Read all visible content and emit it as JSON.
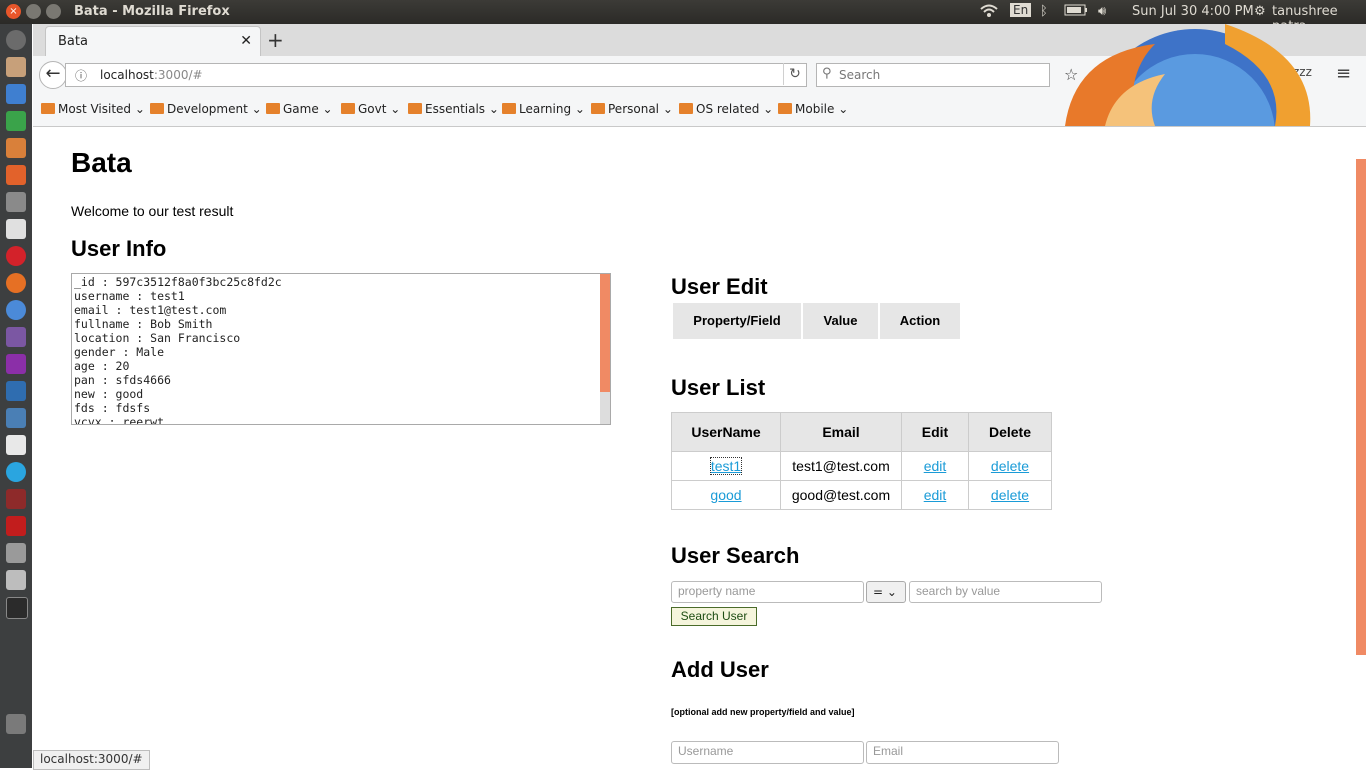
{
  "os": {
    "window_title": "Bata - Mozilla Firefox",
    "keyboard": "En",
    "clock": "Sun Jul 30  4:00 PM",
    "user": "tanushree patra"
  },
  "browser": {
    "tab_title": "Bata",
    "url_host": "localhost",
    "url_rest": ":3000/#",
    "search_placeholder": "Search",
    "bookmarks": [
      "Most Visited",
      "Development",
      "Game",
      "Govt",
      "Essentials",
      "Learning",
      "Personal",
      "OS related",
      "Mobile"
    ],
    "status_url": "localhost:3000/#"
  },
  "page": {
    "title": "Bata",
    "welcome": "Welcome to our test result",
    "user_info": {
      "heading": "User Info",
      "lines": "_id : 597c3512f8a0f3bc25c8fd2c\nusername : test1\nemail : test1@test.com\nfullname : Bob Smith\nlocation : San Francisco\ngender : Male\nage : 20\npan : sfds4666\nnew : good\nfds : fdsfs\nvcvx : reerwt"
    },
    "user_edit": {
      "heading": "User Edit",
      "columns": [
        "Property/Field",
        "Value",
        "Action"
      ]
    },
    "user_list": {
      "heading": "User List",
      "columns": [
        "UserName",
        "Email",
        "Edit",
        "Delete"
      ],
      "rows": [
        {
          "username": "test1",
          "email": "test1@test.com",
          "edit": "edit",
          "delete": "delete"
        },
        {
          "username": "good",
          "email": "good@test.com",
          "edit": "edit",
          "delete": "delete"
        }
      ]
    },
    "user_search": {
      "heading": "User Search",
      "property_placeholder": "property name",
      "operator": "=",
      "value_placeholder": "search by value",
      "button": "Search User"
    },
    "add_user": {
      "heading": "Add User",
      "note": "[optional add new property/field and value]",
      "username_placeholder": "Username",
      "email_placeholder": "Email"
    }
  }
}
